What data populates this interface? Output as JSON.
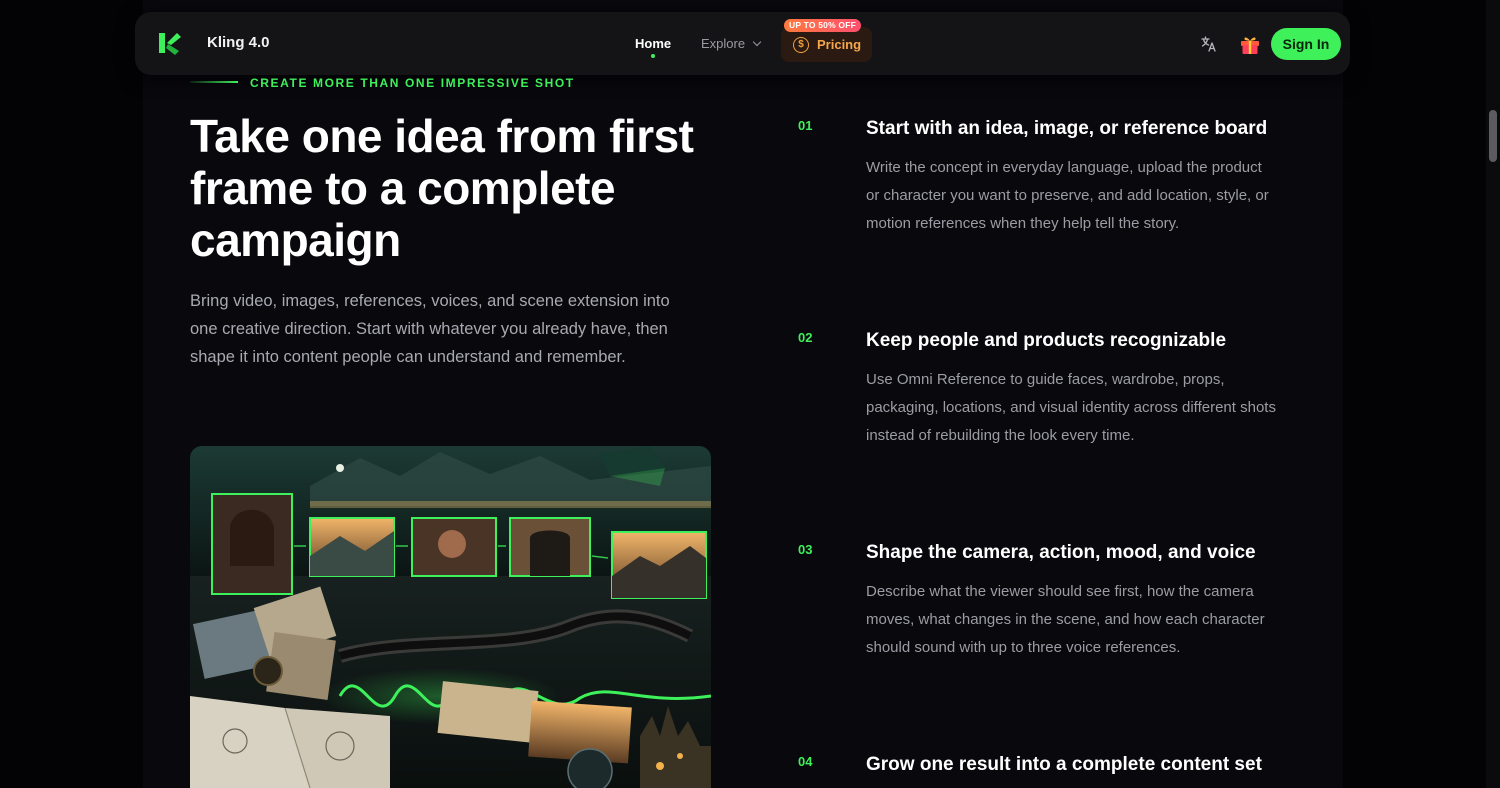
{
  "nav": {
    "brand": "Kling 4.0",
    "home": "Home",
    "explore": "Explore",
    "pricing": "Pricing",
    "promo_badge": "UP TO 50% OFF",
    "coin_symbol": "$",
    "sign_in": "Sign In"
  },
  "hero": {
    "eyebrow": "CREATE MORE THAN ONE IMPRESSIVE SHOT",
    "headline": "Take one idea from first frame to a complete campaign",
    "intro": "Bring video, images, references, voices, and scene extension into one creative direction. Start with whatever you already have, then shape it into content people can understand and remember."
  },
  "steps": [
    {
      "number": "01",
      "title": "Start with an idea, image, or reference board",
      "body": "Write the concept in everyday language, upload the product or character you want to preserve, and add location, style, or motion references when they help tell the story."
    },
    {
      "number": "02",
      "title": "Keep people and products recognizable",
      "body": "Use Omni Reference to guide faces, wardrobe, props, packaging, locations, and visual identity across different shots instead of rebuilding the look every time."
    },
    {
      "number": "03",
      "title": "Shape the camera, action, mood, and voice",
      "body": "Describe what the viewer should see first, how the camera moves, what changes in the scene, and how each character should sound with up to three voice references."
    },
    {
      "number": "04",
      "title": "Grow one result into a complete content set",
      "body": ""
    }
  ],
  "colors": {
    "accent": "#3ef05a",
    "pricing": "#f6a64a",
    "background": "#08080d"
  },
  "icons": [
    "kling-logo-icon",
    "chevron-down-icon",
    "coin-icon",
    "translate-icon",
    "gift-icon"
  ]
}
